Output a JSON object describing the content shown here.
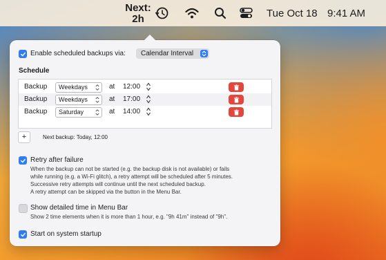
{
  "menubar": {
    "next_line1": "Next:",
    "next_line2": "2h",
    "icons": [
      "time-machine-icon",
      "wifi-icon",
      "search-icon",
      "control-center-icon"
    ],
    "date": "Tue Oct 18",
    "time": "9:41 AM"
  },
  "panel": {
    "enable_label": "Enable scheduled backups via:",
    "enable_checked": true,
    "schedule_method": "Calendar Interval",
    "schedule_title": "Schedule",
    "rows": [
      {
        "label": "Backup",
        "day": "Weekdays",
        "at": "at",
        "time": "12:00"
      },
      {
        "label": "Backup",
        "day": "Weekdays",
        "at": "at",
        "time": "17:00"
      },
      {
        "label": "Backup",
        "day": "Saturday",
        "at": "at",
        "time": "14:00"
      }
    ],
    "add_label": "+",
    "next_backup": "Next backup:  Today, 12:00",
    "retry": {
      "label": "Retry after failure",
      "checked": true,
      "desc": [
        "When the backup can not be started (e.g. the backup disk is not available) or fails",
        "while running (e.g. a Wi-Fi glitch), a retry attempt will be scheduled after 5 minutes.",
        "Successive retry attempts will continue until the next scheduled backup.",
        "A retry attempt can be skipped via the button in the Menu Bar."
      ]
    },
    "detailed": {
      "label": "Show detailed time in Menu Bar",
      "checked": false,
      "desc": "Show 2 time elements when it is more than 1 hour, e.g. \"9h 41m\" instead of \"9h\"."
    },
    "startup": {
      "label": "Start on system startup",
      "checked": true
    }
  },
  "colors": {
    "accent": "#2f7cf6",
    "delete": "#e5463c"
  }
}
